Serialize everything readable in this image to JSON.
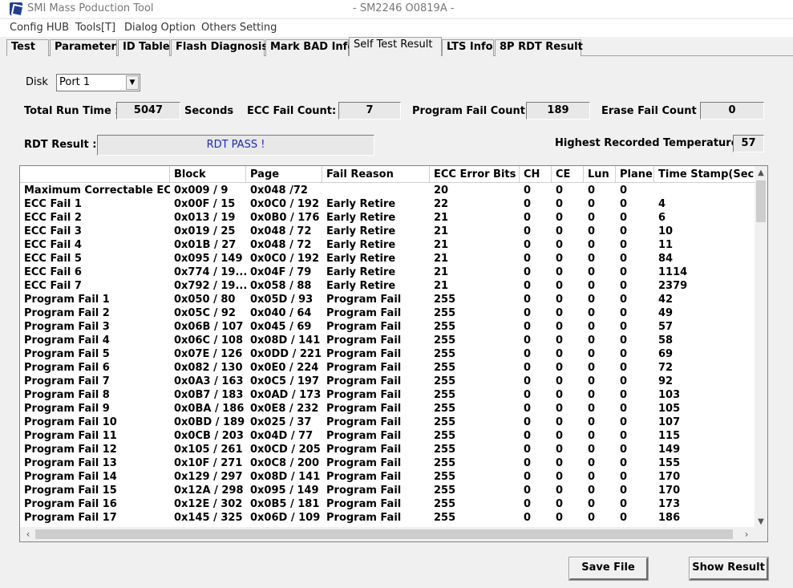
{
  "window": {
    "title": "SMI Mass Poduction Tool",
    "subtitle": "- SM2246 O0819A -"
  },
  "menu": [
    "Config HUB",
    "Tools[T]",
    "Dialog Option",
    "Others Setting"
  ],
  "tabs": [
    "Test",
    "Parameter",
    "ID Table",
    "Flash Diagnosis",
    "Mark BAD Info",
    "Self Test Result",
    "LTS Info",
    "8P RDT Result"
  ],
  "active_tab": "Self Test Result",
  "disk": {
    "label": "Disk",
    "value": "Port 1"
  },
  "stats": {
    "total_run_time_label": "Total Run Time :",
    "total_run_time": "5047",
    "seconds_label": "Seconds",
    "ecc_fail_label": "ECC Fail Count:",
    "ecc_fail": "7",
    "program_fail_label": "Program Fail Count :",
    "program_fail": "189",
    "erase_fail_label": "Erase Fail Count :",
    "erase_fail": "0",
    "rdt_result_label": "RDT Result :",
    "rdt_result": "RDT PASS !",
    "temp_label": "Highest Recorded Temperature :",
    "temp": "57"
  },
  "table": {
    "columns": [
      "",
      "Block",
      "Page",
      "Fail Reason",
      "ECC Error Bits",
      "CH",
      "CE",
      "Lun",
      "Plane",
      "Time Stamp(Secs)"
    ],
    "rows": [
      [
        "Maximum Correctable ECC",
        "0x009 / 9",
        "0x048 /72",
        "",
        "20",
        "0",
        "0",
        "0",
        "0",
        ""
      ],
      [
        "ECC Fail 1",
        "0x00F / 15",
        "0x0C0 / 192",
        "Early Retire",
        "22",
        "0",
        "0",
        "0",
        "0",
        "4"
      ],
      [
        "ECC Fail 2",
        "0x013 / 19",
        "0x0B0 / 176",
        "Early Retire",
        "21",
        "0",
        "0",
        "0",
        "0",
        "6"
      ],
      [
        "ECC Fail 3",
        "0x019 / 25",
        "0x048 / 72",
        "Early Retire",
        "21",
        "0",
        "0",
        "0",
        "0",
        "10"
      ],
      [
        "ECC Fail 4",
        "0x01B / 27",
        "0x048 / 72",
        "Early Retire",
        "21",
        "0",
        "0",
        "0",
        "0",
        "11"
      ],
      [
        "ECC Fail 5",
        "0x095 / 149",
        "0x0C0 / 192",
        "Early Retire",
        "21",
        "0",
        "0",
        "0",
        "0",
        "84"
      ],
      [
        "ECC Fail 6",
        "0x774 / 19...",
        "0x04F / 79",
        "Early Retire",
        "21",
        "0",
        "0",
        "0",
        "0",
        "1114"
      ],
      [
        "ECC Fail 7",
        "0x792 / 19...",
        "0x058 / 88",
        "Early Retire",
        "21",
        "0",
        "0",
        "0",
        "0",
        "2379"
      ],
      [
        "Program Fail 1",
        "0x050 / 80",
        "0x05D / 93",
        "Program Fail",
        "255",
        "0",
        "0",
        "0",
        "0",
        "42"
      ],
      [
        "Program Fail 2",
        "0x05C / 92",
        "0x040 / 64",
        "Program Fail",
        "255",
        "0",
        "0",
        "0",
        "0",
        "49"
      ],
      [
        "Program Fail 3",
        "0x06B / 107",
        "0x045 / 69",
        "Program Fail",
        "255",
        "0",
        "0",
        "0",
        "0",
        "57"
      ],
      [
        "Program Fail 4",
        "0x06C / 108",
        "0x08D / 141",
        "Program Fail",
        "255",
        "0",
        "0",
        "0",
        "0",
        "58"
      ],
      [
        "Program Fail 5",
        "0x07E / 126",
        "0x0DD / 221",
        "Program Fail",
        "255",
        "0",
        "0",
        "0",
        "0",
        "69"
      ],
      [
        "Program Fail 6",
        "0x082 / 130",
        "0x0E0 / 224",
        "Program Fail",
        "255",
        "0",
        "0",
        "0",
        "0",
        "72"
      ],
      [
        "Program Fail 7",
        "0x0A3 / 163",
        "0x0C5 / 197",
        "Program Fail",
        "255",
        "0",
        "0",
        "0",
        "0",
        "92"
      ],
      [
        "Program Fail 8",
        "0x0B7 / 183",
        "0x0AD / 173",
        "Program Fail",
        "255",
        "0",
        "0",
        "0",
        "0",
        "103"
      ],
      [
        "Program Fail 9",
        "0x0BA / 186",
        "0x0E8 / 232",
        "Program Fail",
        "255",
        "0",
        "0",
        "0",
        "0",
        "105"
      ],
      [
        "Program Fail 10",
        "0x0BD / 189",
        "0x025 / 37",
        "Program Fail",
        "255",
        "0",
        "0",
        "0",
        "0",
        "107"
      ],
      [
        "Program Fail 11",
        "0x0CB / 203",
        "0x04D / 77",
        "Program Fail",
        "255",
        "0",
        "0",
        "0",
        "0",
        "115"
      ],
      [
        "Program Fail 12",
        "0x105 / 261",
        "0x0CD / 205",
        "Program Fail",
        "255",
        "0",
        "0",
        "0",
        "0",
        "149"
      ],
      [
        "Program Fail 13",
        "0x10F / 271",
        "0x0C8 / 200",
        "Program Fail",
        "255",
        "0",
        "0",
        "0",
        "0",
        "155"
      ],
      [
        "Program Fail 14",
        "0x129 / 297",
        "0x08D / 141",
        "Program Fail",
        "255",
        "0",
        "0",
        "0",
        "0",
        "170"
      ],
      [
        "Program Fail 15",
        "0x12A / 298",
        "0x095 / 149",
        "Program Fail",
        "255",
        "0",
        "0",
        "0",
        "0",
        "170"
      ],
      [
        "Program Fail 16",
        "0x12E / 302",
        "0x0B5 / 181",
        "Program Fail",
        "255",
        "0",
        "0",
        "0",
        "0",
        "173"
      ],
      [
        "Program Fail 17",
        "0x145 / 325",
        "0x06D / 109",
        "Program Fail",
        "255",
        "0",
        "0",
        "0",
        "0",
        "186"
      ]
    ]
  },
  "buttons": {
    "save": "Save File",
    "show": "Show Result"
  },
  "colors": {
    "rdt_text": "#1a2ab8",
    "background": "#f0f0f0"
  }
}
